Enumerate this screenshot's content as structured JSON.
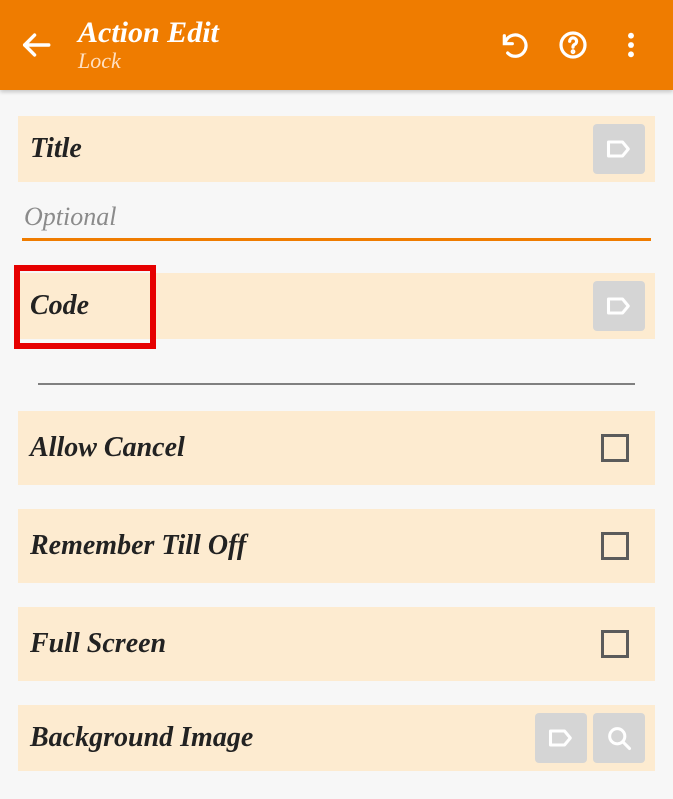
{
  "header": {
    "title": "Action Edit",
    "subtitle": "Lock"
  },
  "sections": {
    "title": {
      "label": "Title",
      "placeholder": "Optional",
      "value": ""
    },
    "code": {
      "label": "Code"
    },
    "allow_cancel": {
      "label": "Allow Cancel",
      "checked": false
    },
    "remember": {
      "label": "Remember Till Off",
      "checked": false
    },
    "full_screen": {
      "label": "Full Screen",
      "checked": false
    },
    "bg_image": {
      "label": "Background Image"
    }
  }
}
